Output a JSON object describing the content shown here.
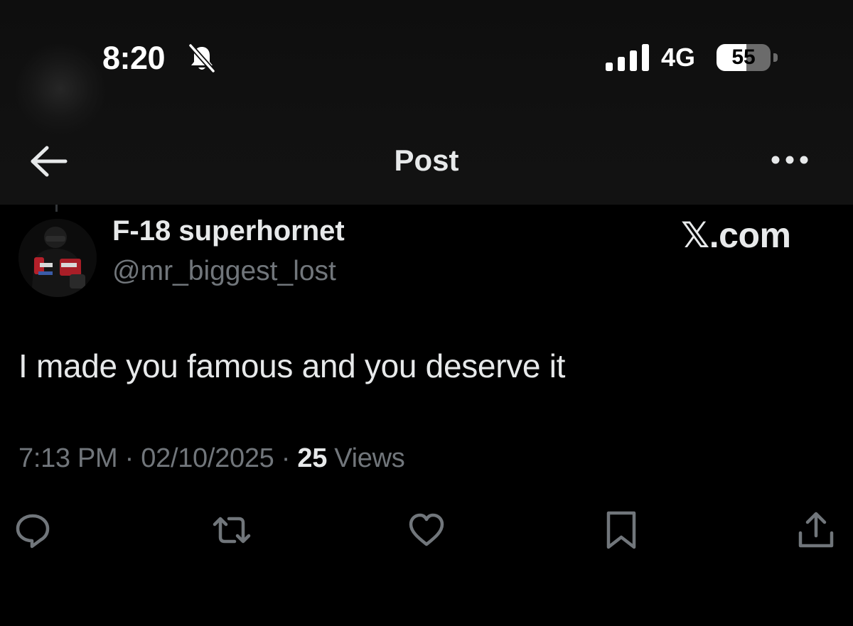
{
  "status_bar": {
    "time": "8:20",
    "network": "4G",
    "battery_level": "55",
    "battery_fraction": 0.55
  },
  "header": {
    "title": "Post"
  },
  "post": {
    "display_name": "F-18 superhornet",
    "handle": "@mr_biggest_lost",
    "watermark": "𝕏.com",
    "text": "I made you famous and you deserve it",
    "time": "7:13 PM",
    "separator": " · ",
    "date": "02/10/2025",
    "views_count": "25",
    "views_label": " Views"
  },
  "actions": [
    {
      "name": "reply",
      "icon": "reply-icon"
    },
    {
      "name": "repost",
      "icon": "repost-icon"
    },
    {
      "name": "like",
      "icon": "heart-icon"
    },
    {
      "name": "bookmark",
      "icon": "bookmark-icon"
    },
    {
      "name": "share",
      "icon": "share-icon"
    }
  ],
  "colors": {
    "background": "#000000",
    "primary_text": "#e7e9ea",
    "secondary_text": "#71767b"
  }
}
